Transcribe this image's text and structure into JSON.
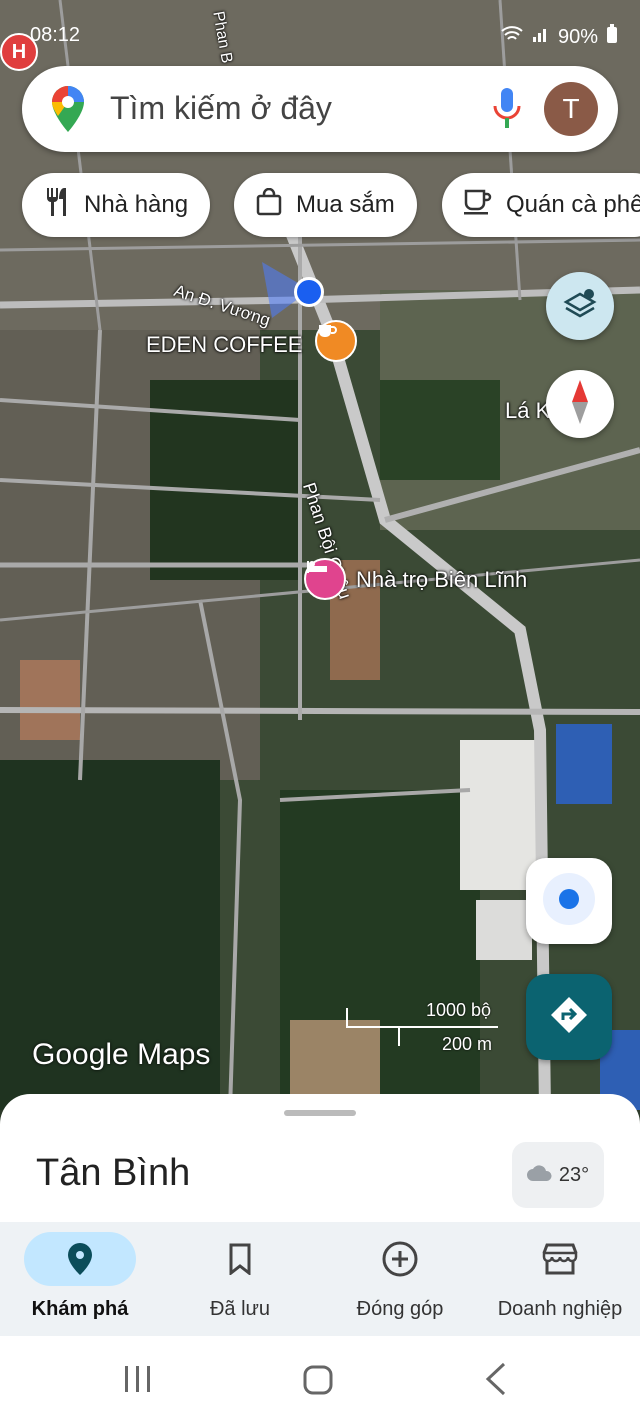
{
  "status_bar": {
    "time": "08:12",
    "battery": "90%"
  },
  "search": {
    "placeholder": "Tìm kiếm ở đây",
    "avatar_initial": "T"
  },
  "chips": [
    {
      "label": "Nhà hàng",
      "icon": "restaurant-icon"
    },
    {
      "label": "Mua sắm",
      "icon": "shopping-bag-icon"
    },
    {
      "label": "Quán cà phê",
      "icon": "coffee-icon"
    }
  ],
  "map": {
    "streets": {
      "an_duong_vuong": "An Đ. Vương",
      "phan_boi_chau": "Phan Bội Châu",
      "top": "Phan B",
      "la": "Lá K"
    },
    "pois": {
      "eden": "EDEN COFFEE",
      "nha_tro": "Nhà trọ Biên Lĩnh",
      "hospital": "H"
    },
    "scale": {
      "feet": "1000 bộ",
      "meters": "200 m"
    },
    "watermark": "Google Maps"
  },
  "sheet": {
    "place": "Tân Bình",
    "temperature": "23°"
  },
  "bottom_nav": [
    {
      "label": "Khám phá",
      "icon": "explore-pin-icon",
      "active": true
    },
    {
      "label": "Đã lưu",
      "icon": "bookmark-icon",
      "active": false
    },
    {
      "label": "Đóng góp",
      "icon": "add-circle-icon",
      "active": false
    },
    {
      "label": "Doanh nghiệp",
      "icon": "storefront-icon",
      "active": false
    }
  ],
  "colors": {
    "accent": "#0b6370",
    "active_pill": "#c2e7ff",
    "location_blue": "#1a5ff0"
  }
}
